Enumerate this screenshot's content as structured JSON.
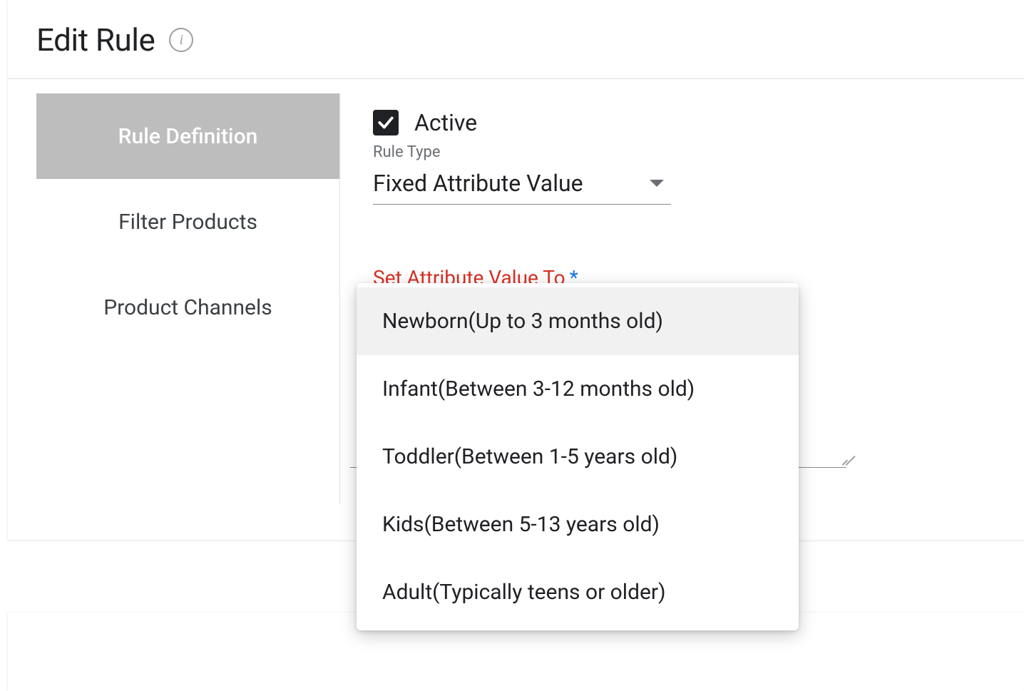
{
  "header": {
    "title": "Edit Rule"
  },
  "tabs": {
    "items": [
      {
        "label": "Rule Definition",
        "active": true
      },
      {
        "label": "Filter Products",
        "active": false
      },
      {
        "label": "Product Channels",
        "active": false
      }
    ]
  },
  "form": {
    "active_checkbox": {
      "checked": true,
      "label": "Active"
    },
    "rule_type": {
      "label": "Rule Type",
      "value": "Fixed Attribute Value"
    },
    "set_attribute": {
      "label": "Set Attribute Value To",
      "required_mark": "*"
    }
  },
  "dropdown": {
    "options": [
      "Newborn(Up to 3 months old)",
      "Infant(Between 3-12 months old)",
      "Toddler(Between 1-5 years old)",
      "Kids(Between 5-13 years old)",
      "Adult(Typically teens or older)"
    ],
    "highlighted_index": 0
  }
}
